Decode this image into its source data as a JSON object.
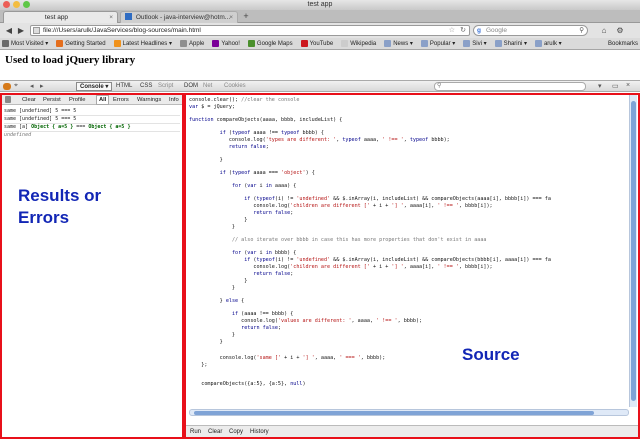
{
  "window": {
    "title": "test app"
  },
  "tabs": [
    {
      "label": "test app",
      "active": true
    },
    {
      "label": "Outlook - java-interview@hotm...",
      "active": false
    }
  ],
  "address_bar": {
    "url": "file:///Users/arulk/JavaServices/blog-sources/main.html"
  },
  "search_bar": {
    "placeholder": "Google"
  },
  "bookmarks": [
    {
      "label": "Most Visited ▾",
      "icon": "most-visited-icon",
      "color": "#6a6a6a"
    },
    {
      "label": "Getting Started",
      "icon": "firefox-icon",
      "color": "#e46e1d"
    },
    {
      "label": "Latest Headlines ▾",
      "icon": "rss-icon",
      "color": "#f0921c"
    },
    {
      "label": "Apple",
      "icon": "apple-icon",
      "color": "#8f8f8f"
    },
    {
      "label": "Yahoo!",
      "icon": "yahoo-icon",
      "color": "#7b0099"
    },
    {
      "label": "Google Maps",
      "icon": "google-maps-icon",
      "color": "#4a8f2c"
    },
    {
      "label": "YouTube",
      "icon": "youtube-icon",
      "color": "#cc181e"
    },
    {
      "label": "Wikipedia",
      "icon": "wikipedia-icon",
      "color": "#cccccc"
    },
    {
      "label": "News ▾",
      "icon": "folder-icon",
      "color": "#8aa0c8"
    },
    {
      "label": "Popular ▾",
      "icon": "folder-icon",
      "color": "#8aa0c8"
    },
    {
      "label": "Sivi ▾",
      "icon": "folder-icon",
      "color": "#8aa0c8"
    },
    {
      "label": "Sharini ▾",
      "icon": "folder-icon",
      "color": "#8aa0c8"
    },
    {
      "label": "arulk ▾",
      "icon": "folder-icon",
      "color": "#8aa0c8"
    }
  ],
  "bookmarks_menu": "Bookmarks",
  "page": {
    "heading": "Used to load jQuery library"
  },
  "firebug": {
    "panel_select": "Console ▾",
    "panel_tabs": [
      {
        "label": "HTML",
        "dim": false
      },
      {
        "label": "CSS",
        "dim": false
      },
      {
        "label": "Script",
        "dim": true
      },
      {
        "label": "DOM",
        "dim": false
      },
      {
        "label": "Net",
        "dim": true
      },
      {
        "label": "Cookies",
        "dim": true
      }
    ],
    "console_toolbar": {
      "clear": "Clear",
      "persist": "Persist",
      "profile": "Profile",
      "filters": [
        "All",
        "Errors",
        "Warnings",
        "Info"
      ],
      "selected_filter": "All"
    },
    "log_lines": [
      {
        "pre": "same [undefined] ",
        "mid": "5 === 5",
        "obj": false
      },
      {
        "pre": "same [undefined] ",
        "mid": "5 === 5",
        "obj": false
      },
      {
        "pre": "same [a] ",
        "o1": "Object { a=5 }",
        "sep": " === ",
        "o2": "Object { a=5 }",
        "obj": true
      }
    ],
    "undefined_line": "undefined",
    "editor_footer": [
      "Run",
      "Clear",
      "Copy",
      "History"
    ]
  },
  "annotations": {
    "left_line1": "Results or",
    "left_line2": "Errors",
    "right": "Source"
  },
  "colors": {
    "highlight_border": "#e8101a",
    "annotation_text": "#1226b5"
  }
}
